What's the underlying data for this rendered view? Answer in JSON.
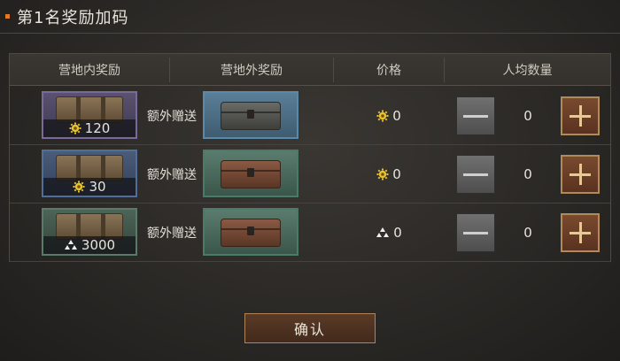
{
  "title": "第1名奖励加码",
  "headers": [
    "营地内奖励",
    "营地外奖励",
    "价格",
    "人均数量"
  ],
  "rows": [
    {
      "inner_value": "120",
      "inner_currency_icon": "gear-coin-icon",
      "extra_label": "额外赠送",
      "outer_item": "steel-chest",
      "price": "0",
      "price_icon": "gear-coin-icon",
      "quantity": "0"
    },
    {
      "inner_value": "30",
      "inner_currency_icon": "gear-coin-icon",
      "extra_label": "额外赠送",
      "outer_item": "wooden-chest",
      "price": "0",
      "price_icon": "gear-coin-icon",
      "quantity": "0"
    },
    {
      "inner_value": "3000",
      "inner_currency_icon": "ore-pile-icon",
      "extra_label": "额外赠送",
      "outer_item": "wooden-chest",
      "price": "0",
      "price_icon": "ore-pile-icon",
      "quantity": "0"
    }
  ],
  "confirm_label": "确认",
  "colors": {
    "accent": "#e07a2a",
    "gear_coin": "#e8c230",
    "plus_border": "#b08a5a",
    "confirm_border": "#b0845a"
  }
}
